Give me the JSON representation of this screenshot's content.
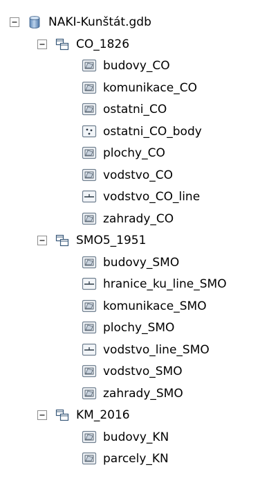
{
  "root": {
    "label": "NAKI-Kunštát.gdb",
    "expanded": true,
    "icon": "database-icon"
  },
  "datasets": [
    {
      "label": "CO_1826",
      "expanded": true,
      "icon": "feature-dataset-icon",
      "feature_classes": [
        {
          "label": "budovy_CO",
          "icon": "polygon-feature-class-icon"
        },
        {
          "label": "komunikace_CO",
          "icon": "polygon-feature-class-icon"
        },
        {
          "label": "ostatni_CO",
          "icon": "polygon-feature-class-icon"
        },
        {
          "label": "ostatni_CO_body",
          "icon": "point-feature-class-icon"
        },
        {
          "label": "plochy_CO",
          "icon": "polygon-feature-class-icon"
        },
        {
          "label": "vodstvo_CO",
          "icon": "polygon-feature-class-icon"
        },
        {
          "label": "vodstvo_CO_line",
          "icon": "line-feature-class-icon"
        },
        {
          "label": "zahrady_CO",
          "icon": "polygon-feature-class-icon"
        }
      ]
    },
    {
      "label": "SMO5_1951",
      "expanded": true,
      "icon": "feature-dataset-icon",
      "feature_classes": [
        {
          "label": "budovy_SMO",
          "icon": "polygon-feature-class-icon"
        },
        {
          "label": "hranice_ku_line_SMO",
          "icon": "line-feature-class-icon"
        },
        {
          "label": "komunikace_SMO",
          "icon": "polygon-feature-class-icon"
        },
        {
          "label": "plochy_SMO",
          "icon": "polygon-feature-class-icon"
        },
        {
          "label": "vodstvo_line_SMO",
          "icon": "line-feature-class-icon"
        },
        {
          "label": "vodstvo_SMO",
          "icon": "polygon-feature-class-icon"
        },
        {
          "label": "zahrady_SMO",
          "icon": "polygon-feature-class-icon"
        }
      ]
    },
    {
      "label": "KM_2016",
      "expanded": true,
      "icon": "feature-dataset-icon",
      "feature_classes": [
        {
          "label": "budovy_KN",
          "icon": "polygon-feature-class-icon"
        },
        {
          "label": "parcely_KN",
          "icon": "polygon-feature-class-icon"
        }
      ]
    }
  ],
  "colors": {
    "toggle_border": "#8c8c8c",
    "icon_border": "#6f7f8f",
    "icon_fill": "#e8eef4",
    "dataset_line": "#3a5a7a",
    "database_blue": "#7fa8d6"
  }
}
